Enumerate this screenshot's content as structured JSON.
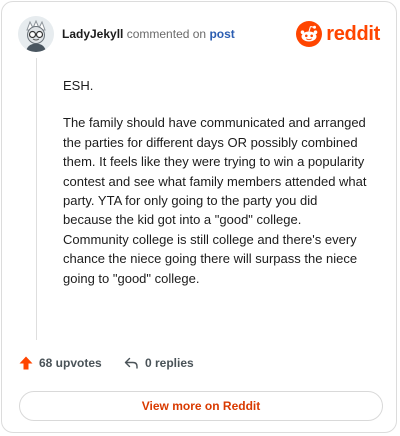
{
  "comment": {
    "username": "LadyJekyll",
    "commented_text": "commented on",
    "post_link": "post",
    "paragraphs": [
      "ESH.",
      "The family should have communicated and arranged the parties for different days OR possibly combined them. It feels like they were trying to win a popularity contest and see what family members attended what party. YTA for only going to the party you did because the kid got into a \"good\" college. Community college is still college and there's every chance the niece going there will surpass the niece going to \"good\" college."
    ]
  },
  "brand": {
    "name": "reddit",
    "color": "#ff4500"
  },
  "actions": {
    "upvotes": "68 upvotes",
    "replies": "0 replies",
    "upvote_icon": "upvote-arrow-icon",
    "reply_icon": "reply-arrow-icon"
  },
  "footer": {
    "view_more": "View more on Reddit",
    "accent": "#d93a00"
  }
}
